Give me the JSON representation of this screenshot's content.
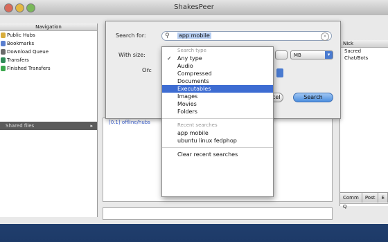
{
  "window": {
    "title": "ShakesPeer"
  },
  "navigation": {
    "header": "Navigation",
    "items": [
      {
        "label": "Public Hubs",
        "color": "#d8ad3c"
      },
      {
        "label": "Bookmarks",
        "color": "#5a7fcf"
      },
      {
        "label": "Download Queue",
        "color": "#6a6a6a"
      },
      {
        "label": "Transfers",
        "color": "#2e8b57"
      },
      {
        "label": "Finished Transfers",
        "color": "#3aa64c"
      }
    ],
    "path_label": "Shared files",
    "path_arrow": "▸"
  },
  "sheet": {
    "search_for_label": "Search for:",
    "search_value": "app mobile",
    "clear_glyph": "×",
    "with_size_label": "With size:",
    "on_label": "On:",
    "size_unit": "MB",
    "cancel_label": "Cancel",
    "search_button": "Search"
  },
  "menu": {
    "search_type_header": "Search type",
    "types": [
      "Any type",
      "Audio",
      "Compressed",
      "Documents",
      "Executables",
      "Images",
      "Movies",
      "Folders"
    ],
    "selected_index": 4,
    "checked_index": 0,
    "check_glyph": "✓",
    "recent_header": "Recent searches",
    "recent": [
      "app mobile",
      "ubuntu linux fedphop"
    ],
    "clear_recent": "Clear recent searches"
  },
  "results": {
    "link_text": "[0.1] offline/hubs"
  },
  "right_panel": {
    "header": "Nick",
    "rows": [
      "Sacred",
      "Chat/Bots"
    ],
    "tabs": [
      "Comm",
      "Post",
      "E"
    ],
    "filter_glyph": "Q"
  }
}
